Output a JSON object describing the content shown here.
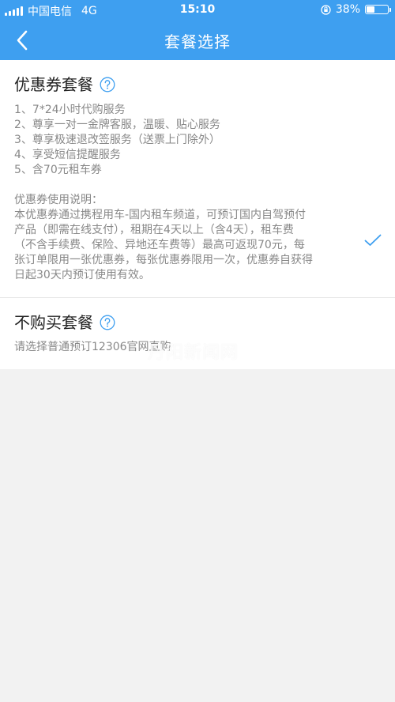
{
  "status_bar": {
    "carrier": "中国电信",
    "network": "4G",
    "time": "15:10",
    "battery": "38%",
    "battery_level": 0.38
  },
  "nav": {
    "title": "套餐选择",
    "back_icon": "chevron-left-icon"
  },
  "packages": [
    {
      "title": "优惠券套餐",
      "features": [
        "1、7*24小时代购服务",
        "2、尊享一对一金牌客服，温暖、贴心服务",
        "3、尊享极速退改签服务（送票上门除外）",
        "4、享受短信提醒服务",
        "5、含70元租车券"
      ],
      "usage_title": "优惠券使用说明：",
      "usage_lines": [
        "本优惠券通过携程用车-国内租车频道，可预订国内自驾预付",
        "产品（即需在线支付），租期在4天以上（含4天），租车费",
        "（不含手续费、保险、异地还车费等）最高可返现70元，每",
        "张订单限用一张优惠券，每张优惠券限用一次，优惠券自获得",
        "日起30天内预订使用有效。"
      ],
      "selected": true
    },
    {
      "title": "不购买套餐",
      "description": "请选择普通预订12306官网直购",
      "selected": false
    }
  ],
  "watermark": "丹阳新闻网",
  "colors": {
    "brand": "#3e9ff0",
    "background": "#f2f2f2",
    "text_secondary": "#888888"
  }
}
